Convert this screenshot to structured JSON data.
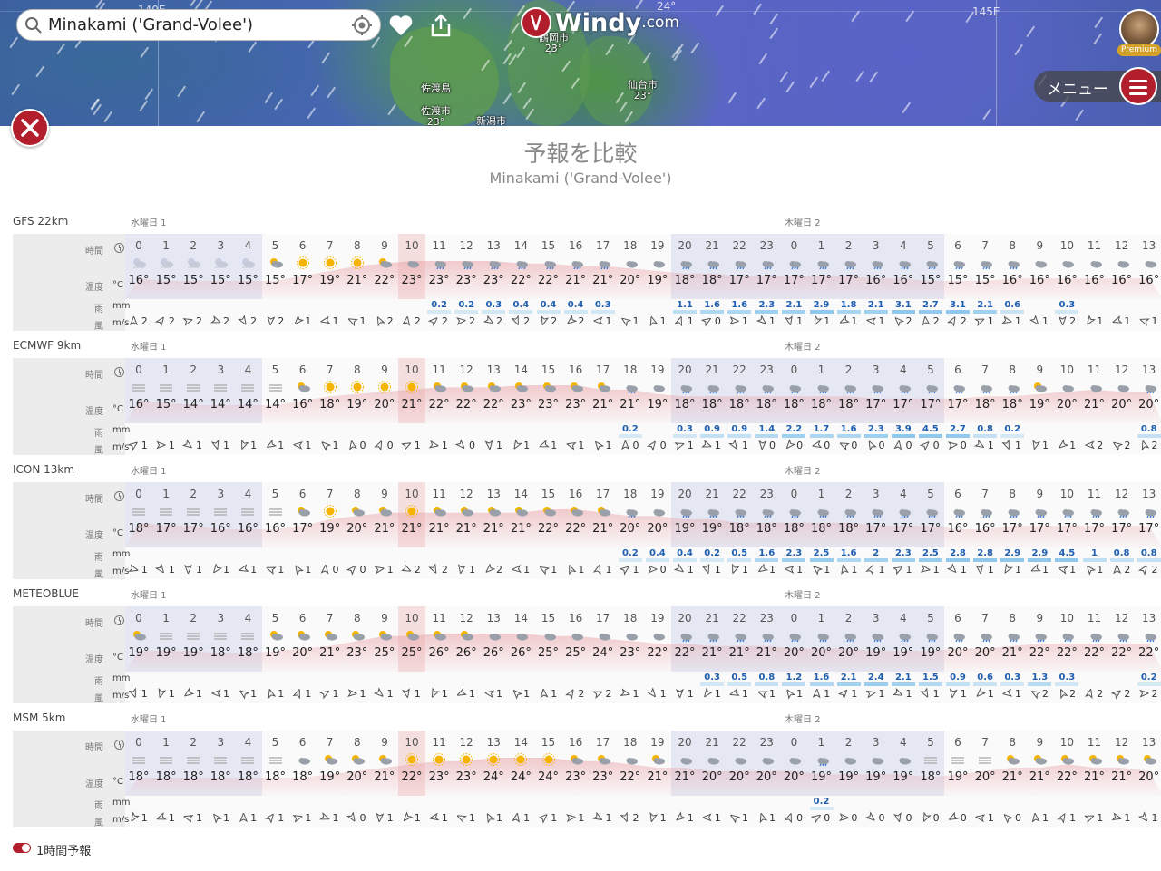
{
  "search": {
    "value": "Minakami ('Grand-Volee')"
  },
  "logo": {
    "text": "Windy",
    "suffix": ".com"
  },
  "avatar": {
    "badge": "Premium"
  },
  "menu": {
    "label": "メニュー"
  },
  "map": {
    "coords": [
      "140E",
      "145E",
      "24°"
    ],
    "places": [
      {
        "name": "鶴岡市",
        "temp": "23°"
      },
      {
        "name": "佐渡島",
        "temp": ""
      },
      {
        "name": "佐渡市",
        "temp": "23°"
      },
      {
        "name": "新潟市",
        "temp": ""
      },
      {
        "name": "仙台市",
        "temp": "23°"
      }
    ]
  },
  "panel": {
    "title": "予報を比較",
    "subtitle": "Minakami ('Grand-Volee')"
  },
  "row_labels": {
    "time": "時間",
    "temp": "温度",
    "temp_unit": "°C",
    "rain": "雨",
    "rain_unit": "mm",
    "wind": "風",
    "wind_unit": "m/s"
  },
  "days": [
    "水曜日 1",
    "木曜日 2"
  ],
  "hours": [
    "0",
    "1",
    "2",
    "3",
    "4",
    "5",
    "6",
    "7",
    "8",
    "9",
    "10",
    "11",
    "12",
    "13",
    "14",
    "15",
    "16",
    "17",
    "18",
    "19",
    "20",
    "21",
    "22",
    "23",
    "0",
    "1",
    "2",
    "3",
    "4",
    "5",
    "6",
    "7",
    "8",
    "9",
    "10",
    "11",
    "12",
    "13"
  ],
  "models": [
    {
      "name": "GFS 22km",
      "icons": [
        "moon-cloud-icon",
        "moon-cloud-icon",
        "moon-cloud-icon",
        "moon-cloud-icon",
        "moon-cloud-icon",
        "sun-cloud-icon",
        "sun-icon",
        "sun-icon",
        "sun-icon",
        "sun-cloud-icon",
        "cloud-icon",
        "rain-cloud-icon",
        "rain-cloud-icon",
        "rain-cloud-icon",
        "rain-cloud-icon",
        "rain-cloud-icon",
        "rain-cloud-icon",
        "rain-cloud-icon",
        "cloud-icon",
        "cloud-icon",
        "rain-cloud-icon",
        "rain-cloud-icon",
        "rain-cloud-icon",
        "rain-cloud-icon",
        "rain-cloud-icon",
        "rain-cloud-icon",
        "rain-cloud-icon",
        "rain-cloud-icon",
        "rain-cloud-icon",
        "rain-cloud-icon",
        "rain-cloud-icon",
        "rain-cloud-icon",
        "rain-cloud-icon",
        "cloud-icon",
        "cloud-icon",
        "cloud-icon",
        "cloud-icon",
        "cloud-icon"
      ],
      "temps": [
        "16°",
        "15°",
        "15°",
        "15°",
        "15°",
        "15°",
        "17°",
        "19°",
        "21°",
        "22°",
        "23°",
        "23°",
        "23°",
        "23°",
        "22°",
        "22°",
        "21°",
        "21°",
        "20°",
        "19°",
        "18°",
        "18°",
        "17°",
        "17°",
        "17°",
        "17°",
        "17°",
        "16°",
        "16°",
        "15°",
        "15°",
        "15°",
        "16°",
        "16°",
        "16°",
        "16°",
        "16°",
        "16°"
      ],
      "rain": [
        "",
        "",
        "",
        "",
        "",
        "",
        "",
        "",
        "",
        "",
        "",
        "0.2",
        "0.2",
        "0.3",
        "0.4",
        "0.4",
        "0.4",
        "0.3",
        "",
        "",
        "1.1",
        "1.6",
        "1.6",
        "2.3",
        "2.1",
        "2.9",
        "1.8",
        "2.1",
        "3.1",
        "2.7",
        "3.1",
        "2.1",
        "0.6",
        "",
        "0.3",
        "",
        "",
        ""
      ],
      "wind": [
        "2",
        "2",
        "2",
        "2",
        "2",
        "2",
        "1",
        "1",
        "1",
        "2",
        "2",
        "2",
        "2",
        "2",
        "2",
        "2",
        "2",
        "1",
        "1",
        "1",
        "1",
        "0",
        "1",
        "1",
        "1",
        "1",
        "1",
        "1",
        "2",
        "2",
        "2",
        "1",
        "1",
        "1",
        "2",
        "1",
        "1",
        "1"
      ]
    },
    {
      "name": "ECMWF 9km",
      "icons": [
        "fog-icon",
        "fog-icon",
        "fog-icon",
        "fog-icon",
        "fog-icon",
        "fog-icon",
        "sun-cloud-icon",
        "sun-icon",
        "sun-icon",
        "sun-icon",
        "sun-icon",
        "sun-cloud-icon",
        "sun-cloud-icon",
        "sun-cloud-icon",
        "sun-cloud-icon",
        "sun-cloud-icon",
        "sun-cloud-icon",
        "sun-cloud-icon",
        "rain-cloud-icon",
        "cloud-icon",
        "rain-cloud-icon",
        "rain-cloud-icon",
        "rain-cloud-icon",
        "rain-cloud-icon",
        "rain-cloud-icon",
        "rain-cloud-icon",
        "rain-cloud-icon",
        "rain-cloud-icon",
        "rain-cloud-icon",
        "rain-cloud-icon",
        "rain-cloud-icon",
        "rain-cloud-icon",
        "rain-cloud-icon",
        "sun-cloud-icon",
        "cloud-icon",
        "cloud-icon",
        "cloud-icon",
        "rain-cloud-icon"
      ],
      "temps": [
        "16°",
        "15°",
        "14°",
        "14°",
        "14°",
        "14°",
        "16°",
        "18°",
        "19°",
        "20°",
        "21°",
        "22°",
        "22°",
        "22°",
        "23°",
        "23°",
        "23°",
        "21°",
        "21°",
        "19°",
        "18°",
        "18°",
        "18°",
        "18°",
        "18°",
        "18°",
        "18°",
        "17°",
        "17°",
        "17°",
        "17°",
        "18°",
        "18°",
        "19°",
        "20°",
        "21°",
        "20°",
        "20°"
      ],
      "rain": [
        "",
        "",
        "",
        "",
        "",
        "",
        "",
        "",
        "",
        "",
        "",
        "",
        "",
        "",
        "",
        "",
        "",
        "",
        "0.2",
        "",
        "0.3",
        "0.9",
        "0.9",
        "1.4",
        "2.2",
        "1.7",
        "1.6",
        "2.3",
        "3.9",
        "4.5",
        "2.7",
        "0.8",
        "0.2",
        "",
        "",
        "",
        "",
        "0.8"
      ],
      "wind": [
        "1",
        "1",
        "1",
        "1",
        "1",
        "1",
        "1",
        "1",
        "0",
        "0",
        "1",
        "1",
        "0",
        "1",
        "1",
        "1",
        "1",
        "1",
        "0",
        "0",
        "1",
        "1",
        "1",
        "0",
        "0",
        "0",
        "0",
        "0",
        "0",
        "0",
        "0",
        "1",
        "1",
        "1",
        "1",
        "2",
        "2",
        "2"
      ]
    },
    {
      "name": "ICON 13km",
      "icons": [
        "fog-icon",
        "fog-icon",
        "fog-icon",
        "fog-icon",
        "fog-icon",
        "fog-icon",
        "sun-cloud-icon",
        "sun-icon",
        "sun-cloud-icon",
        "sun-cloud-icon",
        "sun-icon",
        "sun-cloud-icon",
        "sun-cloud-icon",
        "sun-cloud-icon",
        "sun-cloud-icon",
        "sun-cloud-icon",
        "sun-cloud-icon",
        "sun-cloud-icon",
        "rain-cloud-icon",
        "cloud-icon",
        "rain-cloud-icon",
        "rain-cloud-icon",
        "rain-cloud-icon",
        "rain-cloud-icon",
        "rain-cloud-icon",
        "rain-cloud-icon",
        "rain-cloud-icon",
        "rain-cloud-icon",
        "rain-cloud-icon",
        "rain-cloud-icon",
        "rain-cloud-icon",
        "rain-cloud-icon",
        "rain-cloud-icon",
        "rain-cloud-icon",
        "rain-cloud-icon",
        "rain-cloud-icon",
        "rain-cloud-icon",
        "rain-cloud-icon"
      ],
      "temps": [
        "18°",
        "17°",
        "17°",
        "16°",
        "16°",
        "16°",
        "17°",
        "19°",
        "20°",
        "21°",
        "21°",
        "21°",
        "21°",
        "21°",
        "21°",
        "22°",
        "22°",
        "21°",
        "20°",
        "20°",
        "19°",
        "19°",
        "18°",
        "18°",
        "18°",
        "18°",
        "18°",
        "17°",
        "17°",
        "17°",
        "16°",
        "16°",
        "17°",
        "17°",
        "17°",
        "17°",
        "17°",
        "17°"
      ],
      "rain": [
        "",
        "",
        "",
        "",
        "",
        "",
        "",
        "",
        "",
        "",
        "",
        "",
        "",
        "",
        "",
        "",
        "",
        "",
        "0.2",
        "0.4",
        "0.4",
        "0.2",
        "0.5",
        "1.6",
        "2.3",
        "2.5",
        "1.6",
        "2",
        "2.3",
        "2.5",
        "2.8",
        "2.8",
        "2.9",
        "2.9",
        "4.5",
        "1",
        "0.8",
        "0.8"
      ],
      "wind": [
        "1",
        "1",
        "1",
        "1",
        "1",
        "1",
        "1",
        "0",
        "0",
        "1",
        "2",
        "2",
        "1",
        "2",
        "1",
        "1",
        "1",
        "1",
        "1",
        "0",
        "1",
        "1",
        "1",
        "1",
        "1",
        "1",
        "1",
        "1",
        "1",
        "1",
        "1",
        "1",
        "1",
        "1",
        "1",
        "1",
        "2",
        "2"
      ]
    },
    {
      "name": "METEOBLUE",
      "icons": [
        "sun-cloud-icon",
        "fog-icon",
        "fog-icon",
        "fog-icon",
        "fog-icon",
        "sun-cloud-icon",
        "sun-cloud-icon",
        "sun-cloud-icon",
        "sun-cloud-icon",
        "sun-cloud-icon",
        "sun-cloud-icon",
        "sun-cloud-icon",
        "sun-cloud-icon",
        "cloud-icon",
        "cloud-icon",
        "cloud-icon",
        "cloud-icon",
        "cloud-icon",
        "cloud-icon",
        "cloud-icon",
        "rain-cloud-icon",
        "rain-cloud-icon",
        "rain-cloud-icon",
        "rain-cloud-icon",
        "rain-cloud-icon",
        "rain-cloud-icon",
        "rain-cloud-icon",
        "rain-cloud-icon",
        "rain-cloud-icon",
        "rain-cloud-icon",
        "rain-cloud-icon",
        "rain-cloud-icon",
        "rain-cloud-icon",
        "rain-cloud-icon",
        "rain-cloud-icon",
        "rain-cloud-icon",
        "rain-cloud-icon",
        "rain-cloud-icon"
      ],
      "temps": [
        "19°",
        "19°",
        "19°",
        "18°",
        "18°",
        "19°",
        "20°",
        "21°",
        "23°",
        "25°",
        "25°",
        "26°",
        "26°",
        "26°",
        "26°",
        "25°",
        "25°",
        "24°",
        "23°",
        "22°",
        "22°",
        "21°",
        "21°",
        "21°",
        "20°",
        "20°",
        "20°",
        "19°",
        "19°",
        "19°",
        "20°",
        "20°",
        "21°",
        "22°",
        "22°",
        "22°",
        "22°",
        "22°"
      ],
      "rain": [
        "",
        "",
        "",
        "",
        "",
        "",
        "",
        "",
        "",
        "",
        "",
        "",
        "",
        "",
        "",
        "",
        "",
        "",
        "",
        "",
        "",
        "0.3",
        "0.5",
        "0.8",
        "1.2",
        "1.6",
        "2.1",
        "2.4",
        "2.1",
        "1.5",
        "0.9",
        "0.6",
        "0.3",
        "1.3",
        "0.3",
        "",
        "",
        "0.2"
      ],
      "wind": [
        "1",
        "1",
        "1",
        "1",
        "1",
        "1",
        "1",
        "1",
        "1",
        "1",
        "1",
        "1",
        "1",
        "1",
        "1",
        "1",
        "2",
        "2",
        "1",
        "1",
        "1",
        "1",
        "1",
        "1",
        "1",
        "1",
        "1",
        "1",
        "1",
        "1",
        "1",
        "1",
        "1",
        "2",
        "2",
        "2",
        "2",
        "2"
      ]
    },
    {
      "name": "MSM 5km",
      "icons": [
        "fog-icon",
        "fog-icon",
        "fog-icon",
        "fog-icon",
        "fog-icon",
        "fog-icon",
        "cloud-icon",
        "sun-cloud-icon",
        "sun-cloud-icon",
        "sun-cloud-icon",
        "sun-icon",
        "sun-icon",
        "sun-icon",
        "sun-icon",
        "sun-icon",
        "sun-icon",
        "sun-cloud-icon",
        "sun-cloud-icon",
        "cloud-icon",
        "sun-cloud-icon",
        "cloud-icon",
        "cloud-icon",
        "cloud-icon",
        "cloud-icon",
        "cloud-icon",
        "rain-cloud-icon",
        "cloud-icon",
        "cloud-icon",
        "cloud-icon",
        "fog-icon",
        "fog-icon",
        "fog-icon",
        "sun-cloud-icon",
        "sun-cloud-icon",
        "sun-cloud-icon",
        "sun-cloud-icon",
        "sun-cloud-icon",
        "sun-cloud-icon"
      ],
      "temps": [
        "18°",
        "18°",
        "18°",
        "18°",
        "18°",
        "18°",
        "18°",
        "19°",
        "20°",
        "21°",
        "22°",
        "23°",
        "23°",
        "24°",
        "24°",
        "24°",
        "23°",
        "23°",
        "22°",
        "21°",
        "21°",
        "20°",
        "20°",
        "20°",
        "20°",
        "19°",
        "19°",
        "19°",
        "19°",
        "18°",
        "19°",
        "20°",
        "21°",
        "21°",
        "22°",
        "21°",
        "21°",
        "20°"
      ],
      "rain": [
        "",
        "",
        "",
        "",
        "",
        "",
        "",
        "",
        "",
        "",
        "",
        "",
        "",
        "",
        "",
        "",
        "",
        "",
        "",
        "",
        "",
        "",
        "",
        "",
        "",
        "0.2",
        "",
        "",
        "",
        "",
        "",
        "",
        "",
        "",
        "",
        "",
        "",
        ""
      ],
      "wind": [
        "1",
        "1",
        "1",
        "1",
        "1",
        "1",
        "1",
        "1",
        "0",
        "1",
        "1",
        "1",
        "1",
        "1",
        "1",
        "1",
        "1",
        "1",
        "2",
        "1",
        "1",
        "1",
        "1",
        "1",
        "0",
        "0",
        "0",
        "0",
        "0",
        "0",
        "0",
        "1",
        "0",
        "1",
        "1",
        "1",
        "1",
        "1"
      ]
    }
  ],
  "footer": {
    "toggle_label": "1時間予報"
  },
  "colors": {
    "accent": "#b21e2b",
    "rain": "#1f5fb0",
    "night": "#cdd2eb",
    "now": "#eb9696"
  }
}
